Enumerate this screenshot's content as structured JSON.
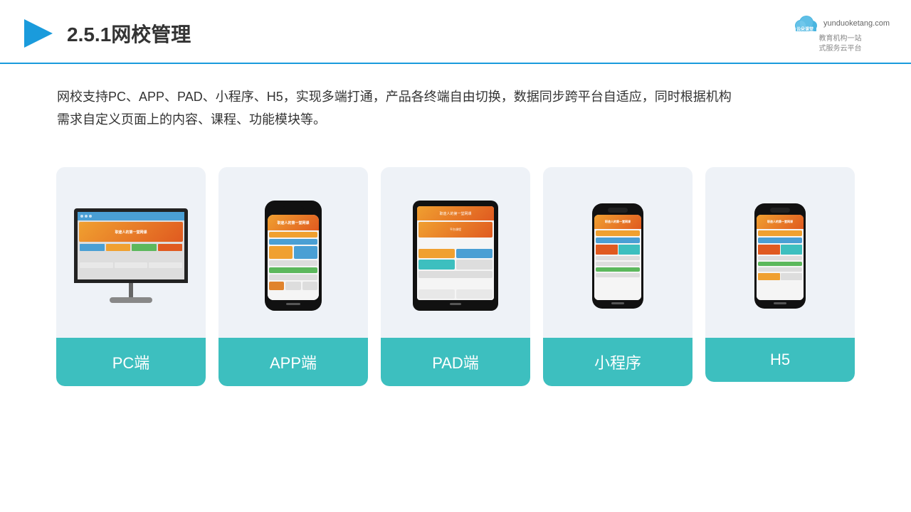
{
  "header": {
    "title": "2.5.1网校管理",
    "logo_main": "云朵课堂",
    "logo_url": "yunduoketang.com",
    "logo_sub": "教育机构一站\n式服务云平台"
  },
  "description": {
    "text": "网校支持PC、APP、PAD、小程序、H5，实现多端打通，产品各终端自由切换，数据同步跨平台自适应，同时根据机构\n需求自定义页面上的内容、课程、功能模块等。"
  },
  "cards": [
    {
      "id": "pc",
      "label": "PC端"
    },
    {
      "id": "app",
      "label": "APP端"
    },
    {
      "id": "pad",
      "label": "PAD端"
    },
    {
      "id": "mini",
      "label": "小程序"
    },
    {
      "id": "h5",
      "label": "H5"
    }
  ],
  "colors": {
    "accent": "#3dbfbf",
    "header_line": "#1a9bdc",
    "card_bg": "#eef2f7"
  }
}
